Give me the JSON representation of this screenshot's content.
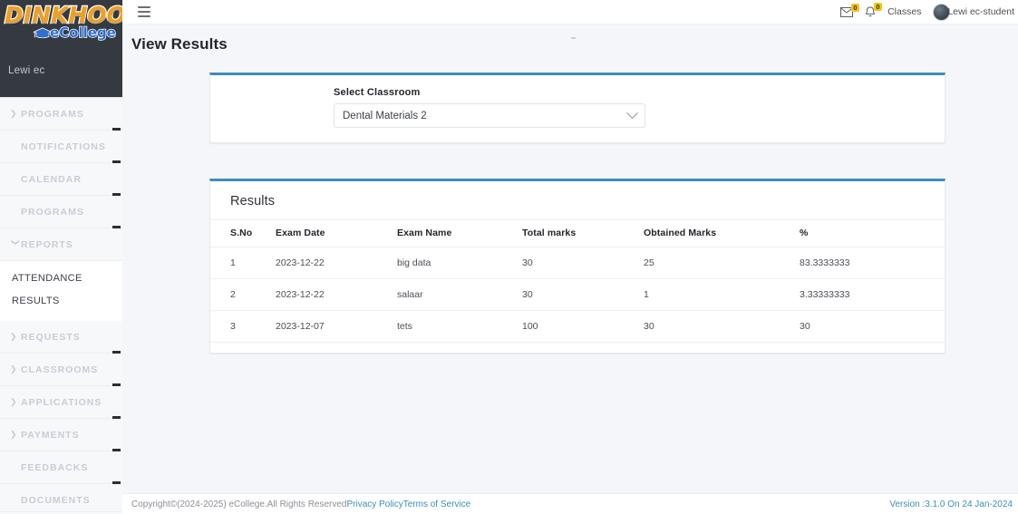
{
  "brand": {
    "logo_word": "DINKHOO!",
    "logo_sub": "eCollege",
    "logo_word_color": "#f0a020",
    "logo_sub_color": "#2f6fd0",
    "sidebar_user": "Lewi ec"
  },
  "sidebar": {
    "items": [
      {
        "label": "PROGRAMS",
        "chevron": "chevron-right-icon",
        "expanded": false
      },
      {
        "label": "NOTIFICATIONS",
        "chevron": "",
        "expanded": false
      },
      {
        "label": "CALENDAR",
        "chevron": "",
        "expanded": false
      },
      {
        "label": "PROGRAMS",
        "chevron": "",
        "expanded": false
      },
      {
        "label": "REPORTS",
        "chevron": "chevron-down-icon",
        "expanded": true,
        "children": [
          {
            "label": "ATTENDANCE"
          },
          {
            "label": "RESULTS"
          }
        ]
      },
      {
        "label": "REQUESTS",
        "chevron": "chevron-right-icon",
        "expanded": false
      },
      {
        "label": "CLASSROOMS",
        "chevron": "chevron-right-icon",
        "expanded": false
      },
      {
        "label": "APPLICATIONS",
        "chevron": "chevron-right-icon",
        "expanded": false
      },
      {
        "label": "PAYMENTS",
        "chevron": "chevron-right-icon",
        "expanded": false
      },
      {
        "label": "FEEDBACKS",
        "chevron": "",
        "expanded": false
      },
      {
        "label": "DOCUMENTS",
        "chevron": "",
        "expanded": false
      }
    ]
  },
  "topbar": {
    "menu_icon": "hamburger-icon",
    "mail_icon": "envelope-icon",
    "mail_badge": "0",
    "bell_icon": "bell-icon",
    "bell_badge": "0",
    "classes_label": "Classes",
    "user_label": "Lewi ec-student",
    "badge_color": "#f5c518"
  },
  "main": {
    "page_title": "View Results",
    "accent_color": "#3c8dbc",
    "select_card": {
      "label": "Select Classroom",
      "selected_value": "Dental Materials 2",
      "chevron": "chevron-down-icon"
    },
    "results_card": {
      "title": "Results",
      "columns": [
        "S.No",
        "Exam Date",
        "Exam Name",
        "Total marks",
        "Obtained Marks",
        "%"
      ],
      "rows": [
        [
          "1",
          "2023-12-22",
          "big data",
          "30",
          "25",
          "83.3333333"
        ],
        [
          "2",
          "2023-12-22",
          "salaar",
          "30",
          "1",
          "3.33333333"
        ],
        [
          "3",
          "2023-12-07",
          "tets",
          "100",
          "30",
          "30"
        ]
      ]
    }
  },
  "footer": {
    "copyright": "Copyright©(2024-2025) eCollege.All Rights Reserved",
    "privacy_link": "Privacy Policy",
    "terms_link": "Terms of Service",
    "version": "Version :3.1.0 On 24 Jan-2024",
    "link_color": "#3c8dbc"
  }
}
